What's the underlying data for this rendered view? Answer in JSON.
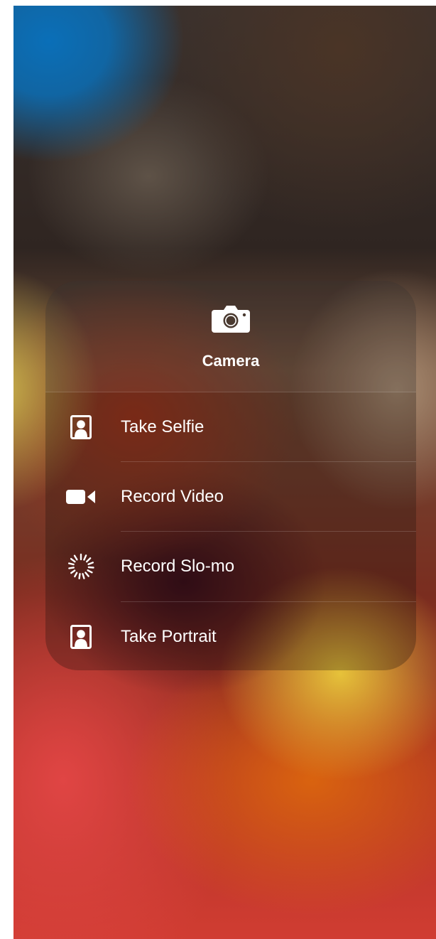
{
  "menu": {
    "title": "Camera",
    "header_icon": "camera-icon",
    "items": [
      {
        "label": "Take Selfie",
        "icon": "selfie-portrait-icon"
      },
      {
        "label": "Record Video",
        "icon": "video-camera-icon"
      },
      {
        "label": "Record Slo-mo",
        "icon": "slo-mo-icon"
      },
      {
        "label": "Take Portrait",
        "icon": "portrait-icon"
      }
    ]
  },
  "colors": {
    "text": "#ffffff"
  }
}
